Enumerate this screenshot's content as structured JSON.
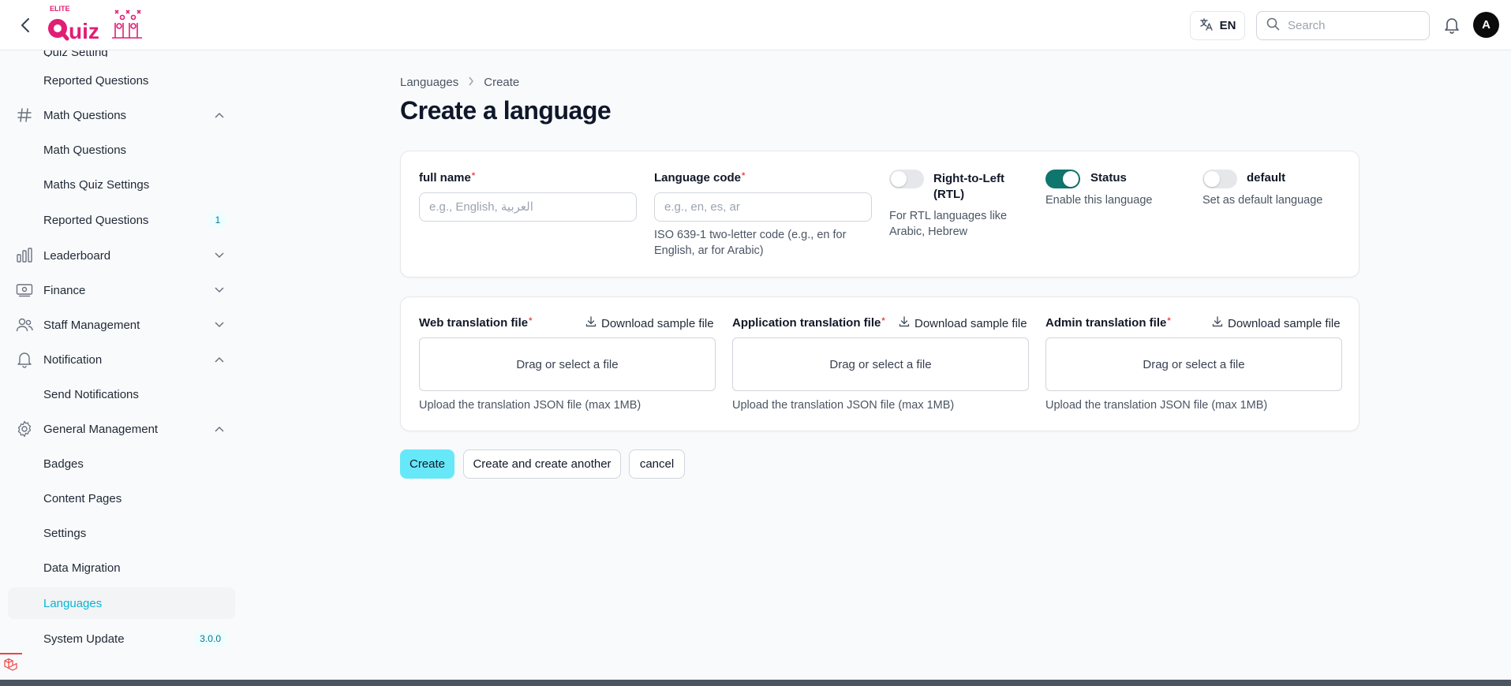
{
  "topbar": {
    "logo_brand": "ELITE",
    "logo_text": "Quiz",
    "language_label": "EN",
    "search_placeholder": "Search",
    "avatar_initial": "A"
  },
  "sidebar": {
    "cut_off_label": "Quiz Setting",
    "items": [
      {
        "label": "Reported Questions",
        "type": "sub"
      },
      {
        "label": "Math Questions",
        "type": "group",
        "icon": "hash-icon",
        "expanded": true
      },
      {
        "label": "Math Questions",
        "type": "sub"
      },
      {
        "label": "Maths Quiz Settings",
        "type": "sub"
      },
      {
        "label": "Reported Questions",
        "type": "sub",
        "badge": "1"
      },
      {
        "label": "Leaderboard",
        "type": "group",
        "icon": "chart-bars-icon",
        "expanded": false
      },
      {
        "label": "Finance",
        "type": "group",
        "icon": "banknote-icon",
        "expanded": false
      },
      {
        "label": "Staff Management",
        "type": "group",
        "icon": "users-icon",
        "expanded": false
      },
      {
        "label": "Notification",
        "type": "group",
        "icon": "bell-icon",
        "expanded": true
      },
      {
        "label": "Send Notifications",
        "type": "sub"
      },
      {
        "label": "General Management",
        "type": "group",
        "icon": "gear-icon",
        "expanded": true
      },
      {
        "label": "Badges",
        "type": "sub"
      },
      {
        "label": "Content Pages",
        "type": "sub"
      },
      {
        "label": "Settings",
        "type": "sub"
      },
      {
        "label": "Data Migration",
        "type": "sub"
      },
      {
        "label": "Languages",
        "type": "sub",
        "active": true
      },
      {
        "label": "System Update",
        "type": "sub",
        "badge": "3.0.0"
      }
    ]
  },
  "breadcrumb": {
    "parent": "Languages",
    "current": "Create"
  },
  "page_title": "Create a language",
  "form": {
    "full_name": {
      "label": "full name",
      "placeholder": "e.g., English, العربية",
      "value": ""
    },
    "language_code": {
      "label": "Language code",
      "placeholder": "e.g., en, es, ar",
      "value": "",
      "helper_line1": "ISO 639-1 two-letter code (e.g., en for",
      "helper_line2": "English, ar for Arabic)"
    },
    "rtl": {
      "label_line1": "Right-to-Left",
      "label_line2": "(RTL)",
      "helper_line1": "For RTL languages like",
      "helper_line2": "Arabic, Hebrew",
      "on": false
    },
    "status": {
      "label": "Status",
      "helper": "Enable this language",
      "on": true
    },
    "default": {
      "label": "default",
      "helper": "Set as default language",
      "on": false
    }
  },
  "files": [
    {
      "label": "Web translation file",
      "download": "Download sample file",
      "dropzone": "Drag or select a file",
      "helper": "Upload the translation JSON file (max 1MB)"
    },
    {
      "label": "Application translation file",
      "download": "Download sample file",
      "dropzone": "Drag or select a file",
      "helper": "Upload the translation JSON file (max 1MB)"
    },
    {
      "label": "Admin translation file",
      "download": "Download sample file",
      "dropzone": "Drag or select a file",
      "helper": "Upload the translation JSON file (max 1MB)"
    }
  ],
  "actions": {
    "create": "Create",
    "create_another": "Create and create another",
    "cancel": "cancel"
  },
  "colors": {
    "accent": "#06b6d4",
    "primary_button": "#67e8f9",
    "toggle_on": "#0f766e",
    "required": "#ef4444",
    "logo": "#e11d74"
  }
}
